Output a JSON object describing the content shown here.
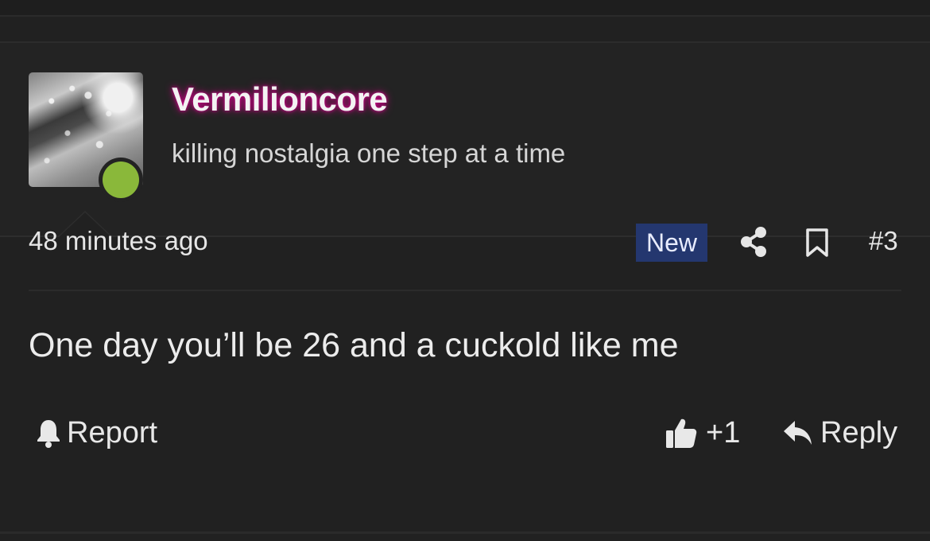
{
  "user": {
    "name": "Vermilioncore",
    "title": "killing nostalgia one step at a time",
    "online": true
  },
  "post": {
    "time": "48 minutes ago",
    "badge": "New",
    "number": "#3",
    "message": "One day you’ll be 26 and a cuckold like me"
  },
  "actions": {
    "report": "Report",
    "like_count": "+1",
    "reply": "Reply"
  },
  "icons": {
    "share": "share-icon",
    "bookmark": "bookmark-icon",
    "report": "bell-icon",
    "like": "thumbs-up-icon",
    "reply": "reply-arrow-icon"
  },
  "colors": {
    "background": "#212121",
    "username_glow": "#d6008c",
    "online_status": "#8ab83a",
    "new_badge": "#24376f"
  }
}
